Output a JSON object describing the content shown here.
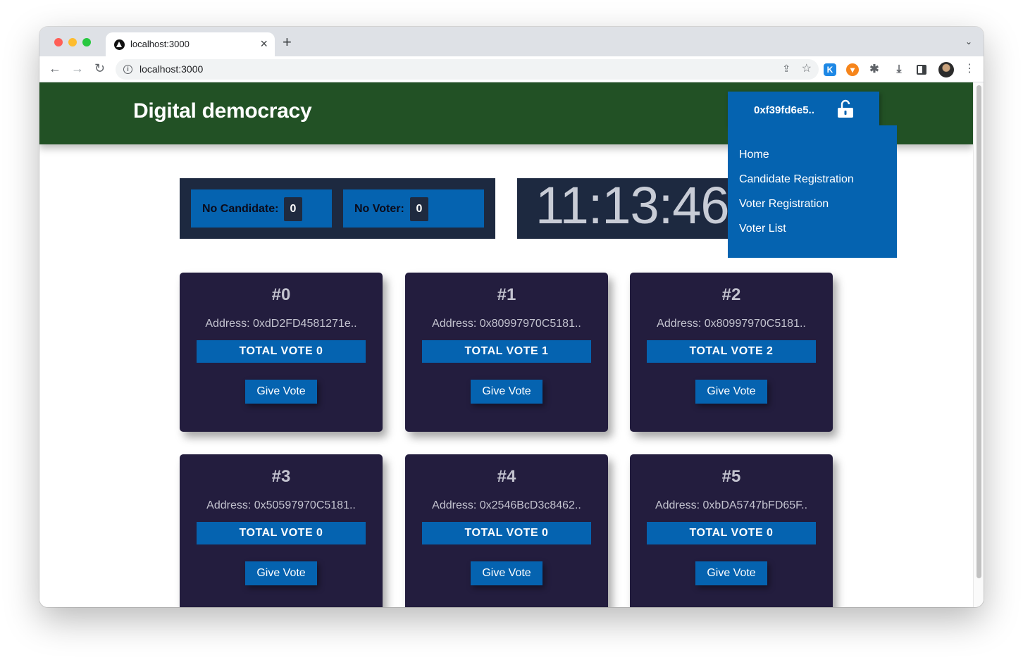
{
  "browser": {
    "tab_title": "localhost:3000",
    "tab_close": "×",
    "new_tab": "+",
    "tab_menu": "⌄",
    "url": "localhost:3000",
    "info": "i"
  },
  "site": {
    "title": "Digital democracy",
    "account_address": "0xf39fd6e5.."
  },
  "menu": {
    "items": [
      {
        "label": "Home"
      },
      {
        "label": "Candidate Registration"
      },
      {
        "label": "Voter Registration"
      },
      {
        "label": "Voter List"
      }
    ]
  },
  "stats": {
    "candidate_label": "No Candidate:",
    "candidate_count": "0",
    "voter_label": "No Voter:",
    "voter_count": "0"
  },
  "clock": {
    "time": "11:13:46"
  },
  "candidates": [
    {
      "num": "#0",
      "address": "Address: 0xdD2FD4581271e..",
      "total": "TOTAL VOTE 0",
      "button": "Give Vote"
    },
    {
      "num": "#1",
      "address": "Address: 0x80997970C5181..",
      "total": "TOTAL VOTE 1",
      "button": "Give Vote"
    },
    {
      "num": "#2",
      "address": "Address: 0x80997970C5181..",
      "total": "TOTAL VOTE 2",
      "button": "Give Vote"
    },
    {
      "num": "#3",
      "address": "Address: 0x50597970C5181..",
      "total": "TOTAL VOTE 0",
      "button": "Give Vote"
    },
    {
      "num": "#4",
      "address": "Address: 0x2546BcD3c8462..",
      "total": "TOTAL VOTE 0",
      "button": "Give Vote"
    },
    {
      "num": "#5",
      "address": "Address: 0xbDA5747bFD65F..",
      "total": "TOTAL VOTE 0",
      "button": "Give Vote"
    }
  ],
  "colors": {
    "header_green": "#225125",
    "accent_blue": "#0563b0",
    "card_navy": "#231d3e",
    "panel_navy": "#1d2940"
  }
}
